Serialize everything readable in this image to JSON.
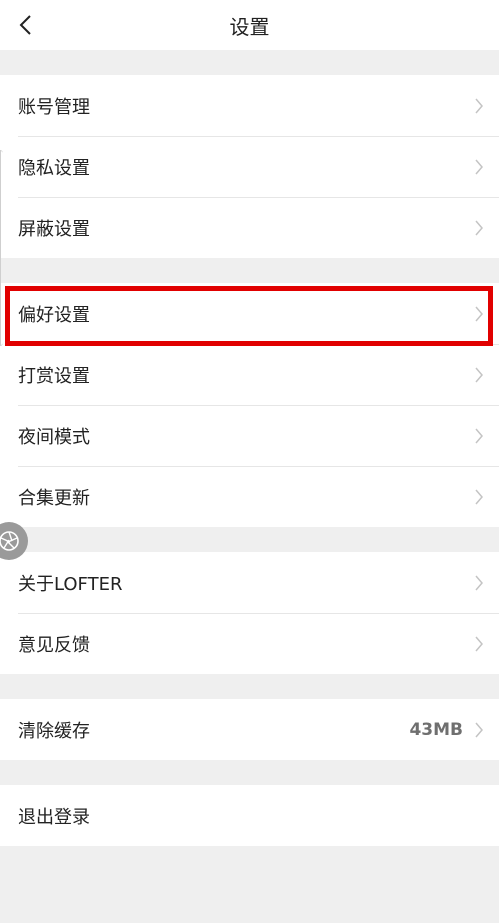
{
  "header": {
    "title": "设置"
  },
  "groups": [
    {
      "items": [
        {
          "label": "账号管理"
        },
        {
          "label": "隐私设置"
        },
        {
          "label": "屏蔽设置"
        }
      ]
    },
    {
      "items": [
        {
          "label": "偏好设置"
        },
        {
          "label": "打赏设置"
        },
        {
          "label": "夜间模式"
        },
        {
          "label": "合集更新"
        }
      ]
    },
    {
      "items": [
        {
          "label": "关于LOFTER"
        },
        {
          "label": "意见反馈"
        }
      ]
    },
    {
      "items": [
        {
          "label": "清除缓存",
          "value": "43MB"
        }
      ]
    },
    {
      "items": [
        {
          "label": "退出登录"
        }
      ]
    }
  ],
  "colors": {
    "highlight": "#e10000",
    "background": "#efefef"
  }
}
